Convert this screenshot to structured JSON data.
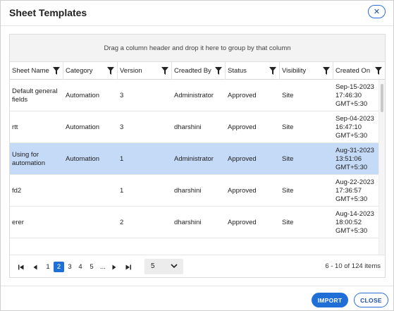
{
  "dialog": {
    "title": "Sheet Templates",
    "close_icon": "close-icon",
    "close_glyph": "✕"
  },
  "grid": {
    "group_panel_text": "Drag a column header and drop it here to group by that column",
    "columns": [
      {
        "label": "Sheet Name"
      },
      {
        "label": "Category"
      },
      {
        "label": "Version"
      },
      {
        "label": "Creadted By"
      },
      {
        "label": "Status"
      },
      {
        "label": "Visibility"
      },
      {
        "label": "Created On"
      }
    ],
    "rows": [
      {
        "sheet_name": "Default general fields",
        "category": "Automation",
        "version": "3",
        "created_by": "Administrator",
        "status": "Approved",
        "visibility": "Site",
        "created_on": [
          "Sep-15-2023",
          "17:46:30",
          "GMT+5:30"
        ],
        "selected": false
      },
      {
        "sheet_name": "rtt",
        "category": "Automation",
        "version": "3",
        "created_by": "dharshini",
        "status": "Approved",
        "visibility": "Site",
        "created_on": [
          "Sep-04-2023",
          "16:47:10",
          "GMT+5:30"
        ],
        "selected": false
      },
      {
        "sheet_name": "Using for automation",
        "category": "Automation",
        "version": "1",
        "created_by": "Administrator",
        "status": "Approved",
        "visibility": "Site",
        "created_on": [
          "Aug-31-2023",
          "13:51:06",
          "GMT+5:30"
        ],
        "selected": true
      },
      {
        "sheet_name": "fd2",
        "category": "",
        "version": "1",
        "created_by": "dharshini",
        "status": "Approved",
        "visibility": "Site",
        "created_on": [
          "Aug-22-2023",
          "17:36:57",
          "GMT+5:30"
        ],
        "selected": false
      },
      {
        "sheet_name": "erer",
        "category": "",
        "version": "2",
        "created_by": "dharshini",
        "status": "Approved",
        "visibility": "Site",
        "created_on": [
          "Aug-14-2023",
          "18:00:52",
          "GMT+5:30"
        ],
        "selected": false
      }
    ],
    "selected_color": "#c5daf7"
  },
  "pager": {
    "pages": [
      "1",
      "2",
      "3",
      "4",
      "5",
      "..."
    ],
    "current_page": "2",
    "page_size": "5",
    "info": "6 - 10 of 124 items"
  },
  "footer": {
    "import_label": "IMPORT",
    "close_label": "CLOSE"
  },
  "colors": {
    "accent": "#1f6fd6"
  }
}
